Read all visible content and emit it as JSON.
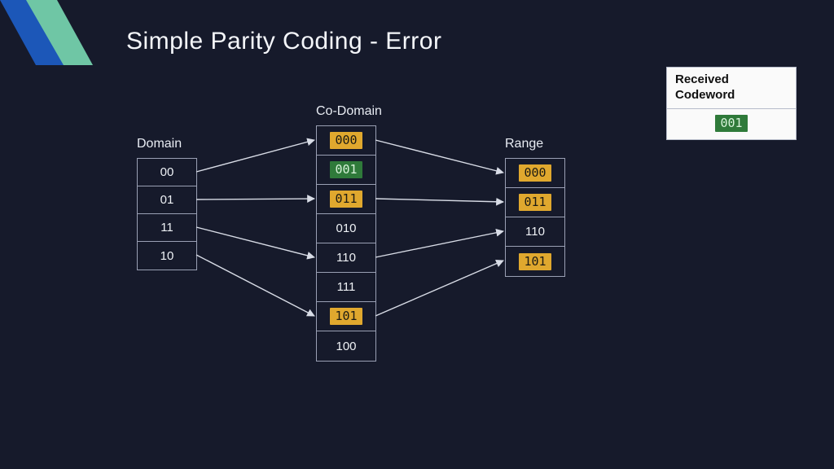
{
  "title": "Simple Parity Coding - Error",
  "labels": {
    "domain": "Domain",
    "codomain": "Co-Domain",
    "range": "Range"
  },
  "domain": [
    "00",
    "01",
    "11",
    "10"
  ],
  "codomain": [
    "000",
    "001",
    "011",
    "010",
    "110",
    "111",
    "101",
    "100"
  ],
  "range": [
    "000",
    "011",
    "110",
    "101"
  ],
  "codomain_highlight": {
    "amber": [
      0,
      2,
      6
    ],
    "green": [
      1
    ]
  },
  "range_highlight": {
    "amber": [
      0,
      1,
      3
    ],
    "green": []
  },
  "received": {
    "header": "Received Codeword",
    "value": "001",
    "value_style": "green"
  },
  "mappings_domain_to_codomain": [
    {
      "from": 0,
      "to": 0
    },
    {
      "from": 1,
      "to": 2
    },
    {
      "from": 2,
      "to": 4
    },
    {
      "from": 3,
      "to": 6
    }
  ],
  "mappings_codomain_to_range": [
    {
      "from": 0,
      "to": 0
    },
    {
      "from": 2,
      "to": 1
    },
    {
      "from": 4,
      "to": 2
    },
    {
      "from": 6,
      "to": 3
    }
  ]
}
